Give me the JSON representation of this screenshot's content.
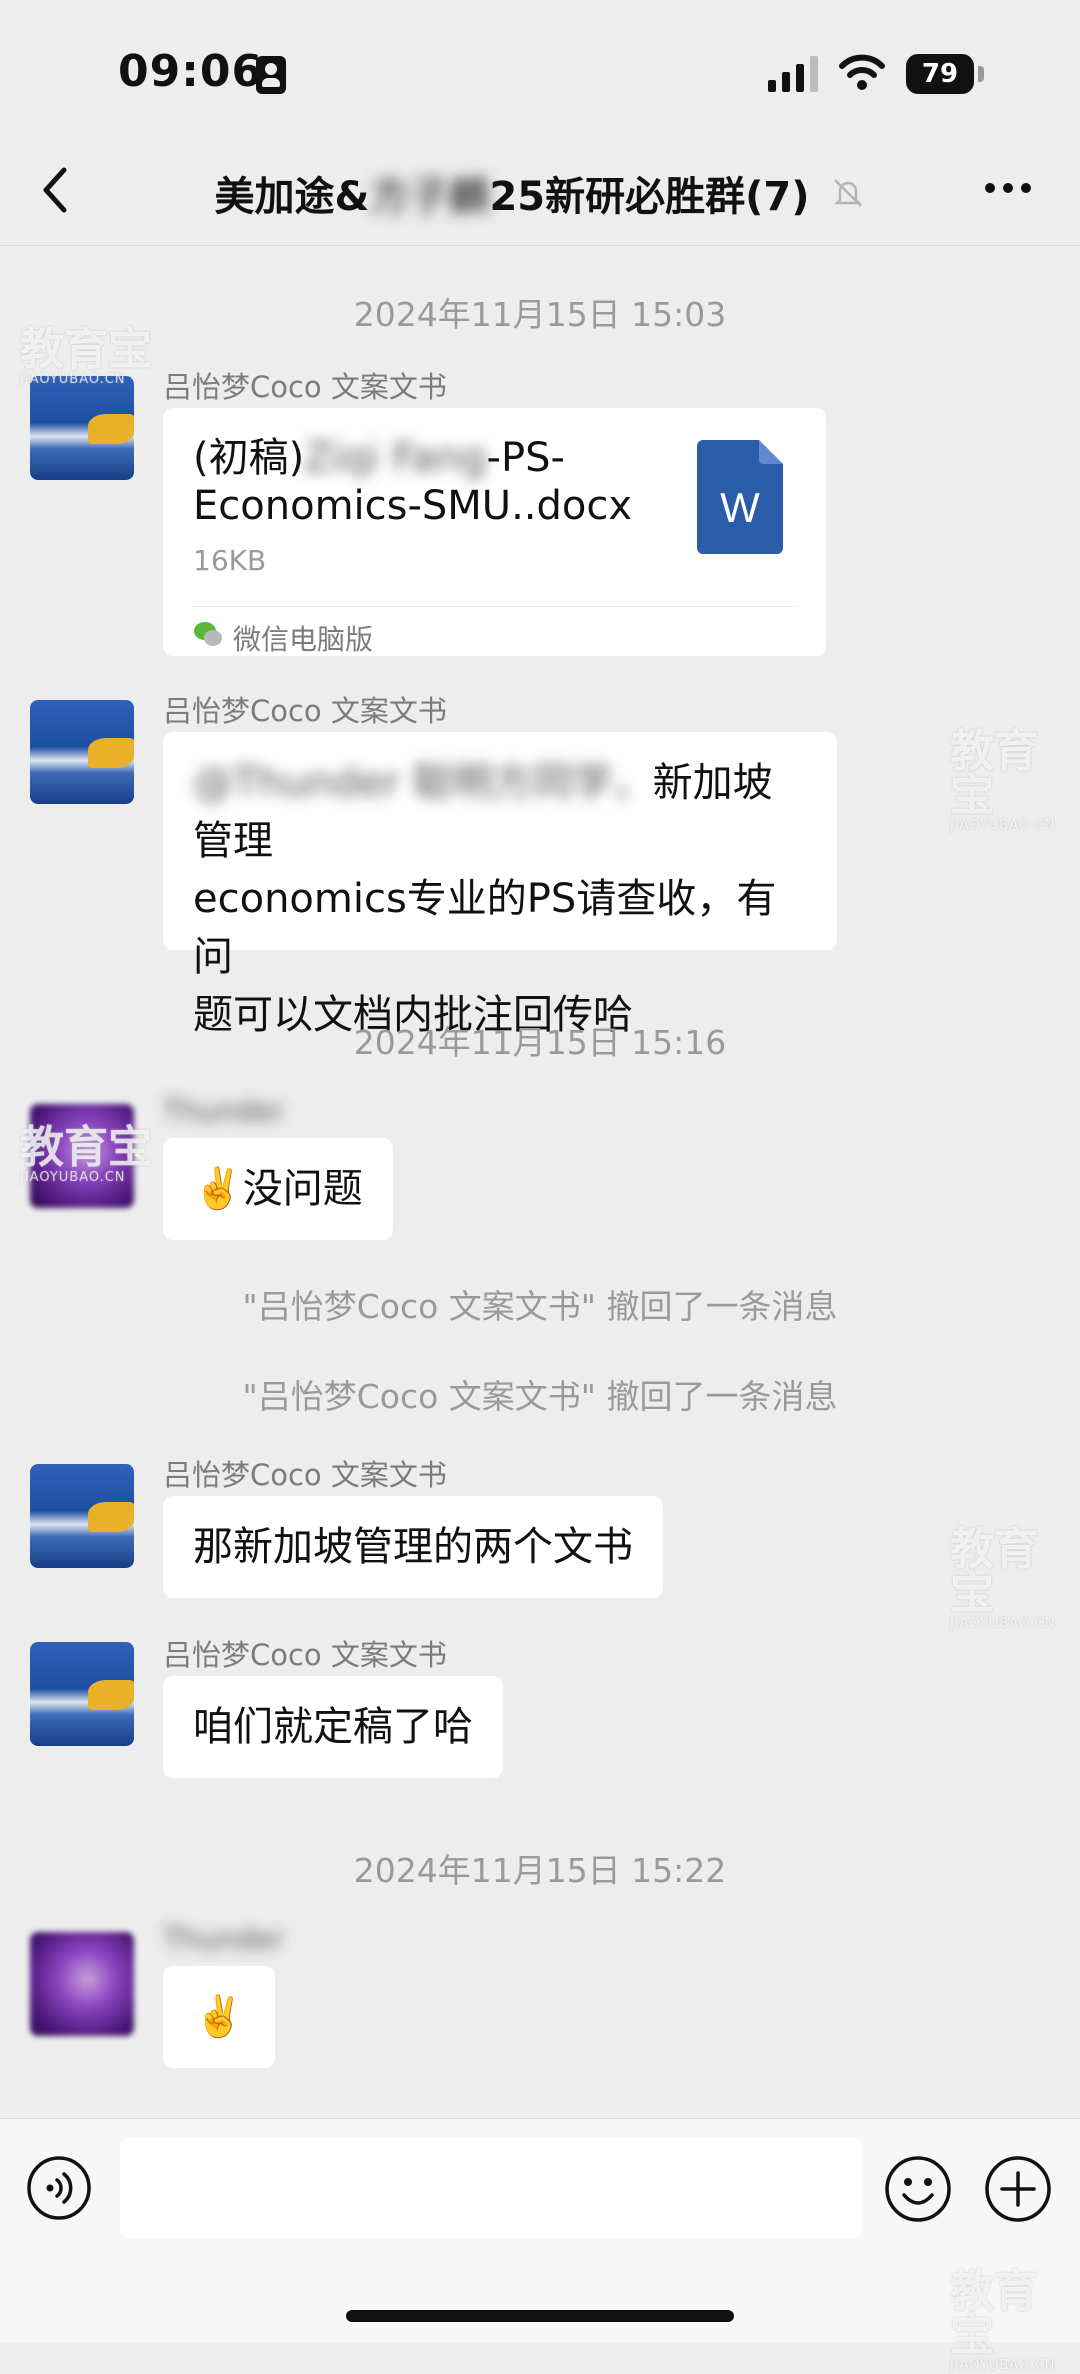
{
  "status_bar": {
    "time": "09:06",
    "battery": "79"
  },
  "nav": {
    "title_prefix": "美加途&",
    "title_blurred": "方子麟",
    "title_suffix": "25新研必胜群(7)"
  },
  "messages": {
    "ts1": "2024年11月15日 15:03",
    "sender_coco": "吕怡梦Coco 文案文书",
    "file_name_prefix": "(初稿)",
    "file_name_blurred": "Ziqi Fang",
    "file_name_suffix1": "-PS-",
    "file_name_line2": "Economics-SMU..docx",
    "file_size": "16KB",
    "file_source": "微信电脑版",
    "file_icon_letter": "W",
    "msg2_blurred": "@Thunder 聪明方同学，",
    "msg2_text1": "新加坡管理",
    "msg2_text2": "economics专业的PS请查收，有问",
    "msg2_text3": "题可以文档内批注回传哈",
    "ts2": "2024年11月15日 15:16",
    "sender_thunder": "Thunder",
    "msg3_emoji": "✌️",
    "msg3_text": "没问题",
    "recall": "\"吕怡梦Coco 文案文书\" 撤回了一条消息",
    "msg4_text": "那新加坡管理的两个文书",
    "msg5_text": "咱们就定稿了哈",
    "ts3": "2024年11月15日 15:22",
    "msg6_emoji": "✌️"
  },
  "watermark": {
    "main": "教育宝",
    "sub": "JIAOYUBAO.CN"
  },
  "icons": {
    "back": "chevron-left-icon",
    "mute": "bell-off-icon",
    "more": "more-dots-icon",
    "voice": "voice-icon",
    "emoji": "smiley-icon",
    "add": "plus-icon",
    "word": "word-file-icon",
    "wechat": "wechat-icon"
  }
}
